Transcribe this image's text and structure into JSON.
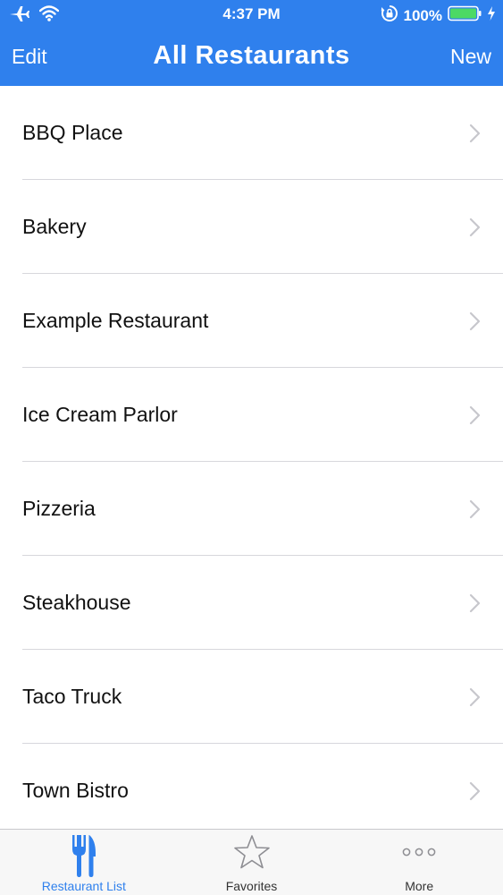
{
  "status_bar": {
    "time": "4:37 PM",
    "battery_percent": "100%",
    "icons": [
      "airplane-icon",
      "wifi-icon",
      "orientation-lock-icon",
      "battery-icon",
      "charging-icon"
    ]
  },
  "nav": {
    "left_label": "Edit",
    "title": "All Restaurants",
    "right_label": "New"
  },
  "restaurants": [
    {
      "name": "BBQ Place"
    },
    {
      "name": "Bakery"
    },
    {
      "name": "Example Restaurant"
    },
    {
      "name": "Ice Cream Parlor"
    },
    {
      "name": "Pizzeria"
    },
    {
      "name": "Steakhouse"
    },
    {
      "name": "Taco Truck"
    },
    {
      "name": "Town Bistro"
    }
  ],
  "tabs": [
    {
      "label": "Restaurant List",
      "icon": "fork-knife-icon",
      "active": true
    },
    {
      "label": "Favorites",
      "icon": "star-icon",
      "active": false
    },
    {
      "label": "More",
      "icon": "more-icon",
      "active": false
    }
  ],
  "colors": {
    "accent": "#2f80ed",
    "battery_fill": "#4cd964",
    "separator": "#d7d7dc",
    "chevron": "#c7c7cc"
  }
}
